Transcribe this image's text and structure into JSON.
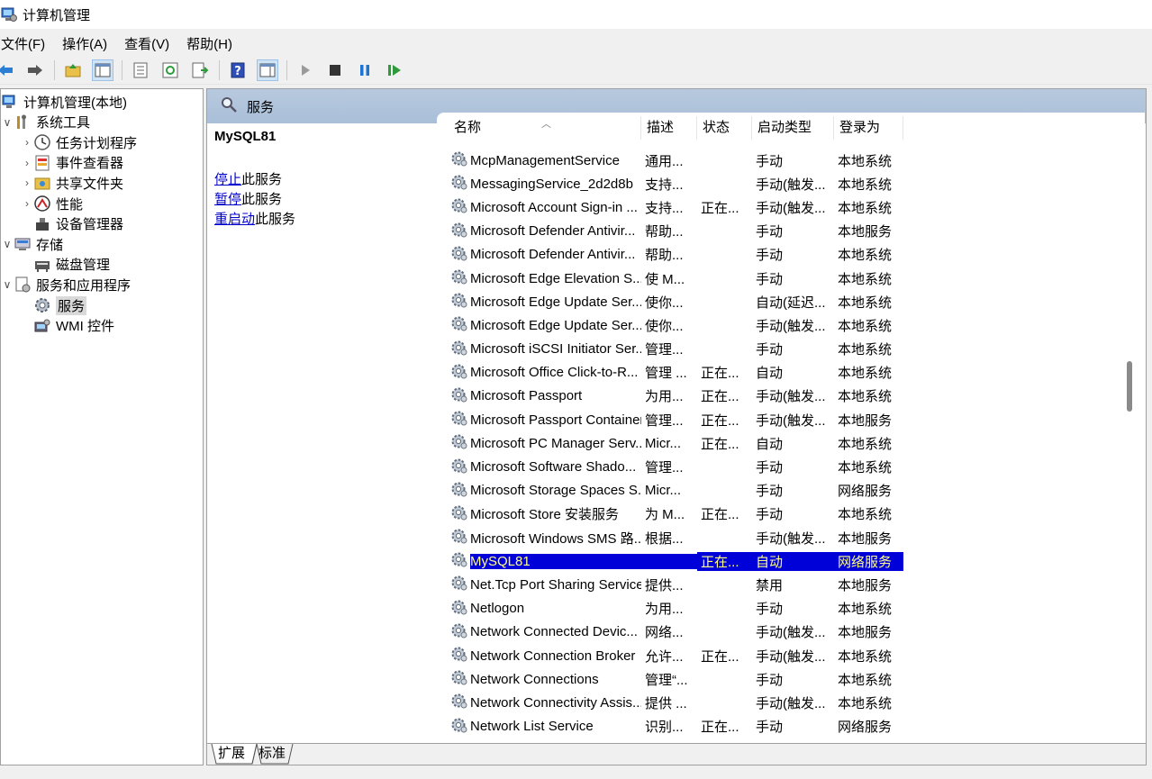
{
  "window": {
    "title": "计算机管理"
  },
  "menu": [
    "文件(F)",
    "操作(A)",
    "查看(V)",
    "帮助(H)"
  ],
  "tree": [
    {
      "label": "计算机管理(本地)",
      "name": "tree-computer-management-local",
      "icon": "computer-management-icon",
      "indent": 0,
      "chevron": ""
    },
    {
      "label": "系统工具",
      "name": "tree-system-tools",
      "icon": "tools-icon",
      "indent": 1,
      "chevron": "∨"
    },
    {
      "label": "任务计划程序",
      "name": "tree-task-scheduler",
      "icon": "clock-icon",
      "indent": 2,
      "chevron": "›"
    },
    {
      "label": "事件查看器",
      "name": "tree-event-viewer",
      "icon": "event-viewer-icon",
      "indent": 2,
      "chevron": "›"
    },
    {
      "label": "共享文件夹",
      "name": "tree-shared-folders",
      "icon": "shared-folder-icon",
      "indent": 2,
      "chevron": "›"
    },
    {
      "label": "性能",
      "name": "tree-performance",
      "icon": "performance-icon",
      "indent": 2,
      "chevron": "›"
    },
    {
      "label": "设备管理器",
      "name": "tree-device-manager",
      "icon": "device-manager-icon",
      "indent": 2,
      "chevron": ""
    },
    {
      "label": "存储",
      "name": "tree-storage",
      "icon": "storage-icon",
      "indent": 1,
      "chevron": "∨"
    },
    {
      "label": "磁盘管理",
      "name": "tree-disk-management",
      "icon": "disk-icon",
      "indent": 2,
      "chevron": ""
    },
    {
      "label": "服务和应用程序",
      "name": "tree-services-and-applications",
      "icon": "services-apps-icon",
      "indent": 1,
      "chevron": "∨"
    },
    {
      "label": "服务",
      "name": "tree-services",
      "icon": "gear-icon",
      "indent": 2,
      "chevron": "",
      "selected": true
    },
    {
      "label": "WMI 控件",
      "name": "tree-wmi-control",
      "icon": "wmi-icon",
      "indent": 2,
      "chevron": ""
    }
  ],
  "services_header": {
    "title": "服务"
  },
  "detail": {
    "title": "MySQL81",
    "links": [
      {
        "link": "停止",
        "rest": "此服务"
      },
      {
        "link": "暂停",
        "rest": "此服务"
      },
      {
        "link": "重启动",
        "rest": "此服务"
      }
    ]
  },
  "columns": [
    "名称",
    "描述",
    "状态",
    "启动类型",
    "登录为"
  ],
  "services": [
    [
      "McpManagementService",
      "通用...",
      "",
      "手动",
      "本地系统"
    ],
    [
      "MessagingService_2d2d8b",
      "支持...",
      "",
      "手动(触发...",
      "本地系统"
    ],
    [
      "Microsoft Account Sign-in ...",
      "支持...",
      "正在...",
      "手动(触发...",
      "本地系统"
    ],
    [
      "Microsoft Defender Antivir...",
      "帮助...",
      "",
      "手动",
      "本地服务"
    ],
    [
      "Microsoft Defender Antivir...",
      "帮助...",
      "",
      "手动",
      "本地系统"
    ],
    [
      "Microsoft Edge Elevation S...",
      "使 M...",
      "",
      "手动",
      "本地系统"
    ],
    [
      "Microsoft Edge Update Ser...",
      "使你...",
      "",
      "自动(延迟...",
      "本地系统"
    ],
    [
      "Microsoft Edge Update Ser...",
      "使你...",
      "",
      "手动(触发...",
      "本地系统"
    ],
    [
      "Microsoft iSCSI Initiator Ser...",
      "管理...",
      "",
      "手动",
      "本地系统"
    ],
    [
      "Microsoft Office Click-to-R...",
      "管理 ...",
      "正在...",
      "自动",
      "本地系统"
    ],
    [
      "Microsoft Passport",
      "为用...",
      "正在...",
      "手动(触发...",
      "本地系统"
    ],
    [
      "Microsoft Passport Container",
      "管理...",
      "正在...",
      "手动(触发...",
      "本地服务"
    ],
    [
      "Microsoft PC Manager Serv...",
      "Micr...",
      "正在...",
      "自动",
      "本地系统"
    ],
    [
      "Microsoft Software Shado...",
      "管理...",
      "",
      "手动",
      "本地系统"
    ],
    [
      "Microsoft Storage Spaces S...",
      "Micr...",
      "",
      "手动",
      "网络服务"
    ],
    [
      "Microsoft Store 安装服务",
      "为 M...",
      "正在...",
      "手动",
      "本地系统"
    ],
    [
      "Microsoft Windows SMS 路...",
      "根据...",
      "",
      "手动(触发...",
      "本地服务"
    ],
    [
      "MySQL81",
      "",
      "正在...",
      "自动",
      "网络服务"
    ],
    [
      "Net.Tcp Port Sharing Service",
      "提供...",
      "",
      "禁用",
      "本地服务"
    ],
    [
      "Netlogon",
      "为用...",
      "",
      "手动",
      "本地系统"
    ],
    [
      "Network Connected Devic...",
      "网络...",
      "",
      "手动(触发...",
      "本地服务"
    ],
    [
      "Network Connection Broker",
      "允许...",
      "正在...",
      "手动(触发...",
      "本地系统"
    ],
    [
      "Network Connections",
      "管理“...",
      "",
      "手动",
      "本地系统"
    ],
    [
      "Network Connectivity Assis...",
      "提供 ...",
      "",
      "手动(触发...",
      "本地系统"
    ],
    [
      "Network List Service",
      "识别...",
      "正在...",
      "手动",
      "网络服务"
    ]
  ],
  "selected_service": "MySQL81",
  "tabs": [
    "扩展",
    "标准"
  ],
  "colors": {
    "selection_bg": "#0000d8",
    "selection_text": "#ffff88",
    "header_bg": "#b1c6dc",
    "link": "#0000cc"
  }
}
